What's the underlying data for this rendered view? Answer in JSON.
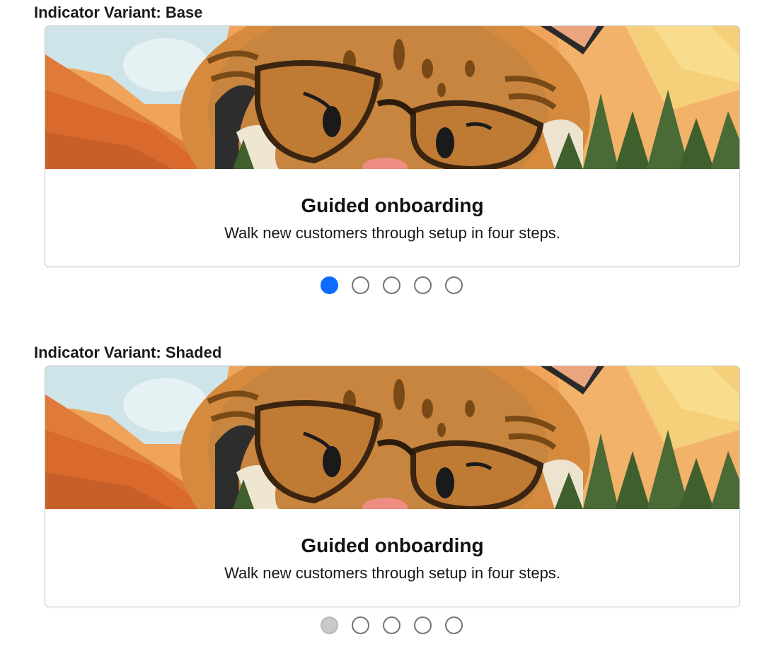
{
  "sections": [
    {
      "title": "Indicator Variant: Base",
      "card": {
        "heading": "Guided onboarding",
        "description": "Walk new customers through setup in four steps.",
        "image_alt": "illustrated-cat-with-glasses-banner"
      },
      "indicators": {
        "count": 5,
        "active_index": 0,
        "active_color": "#0b6cff",
        "style": "base"
      }
    },
    {
      "title": "Indicator Variant: Shaded",
      "card": {
        "heading": "Guided onboarding",
        "description": "Walk new customers through setup in four steps.",
        "image_alt": "illustrated-cat-with-glasses-banner"
      },
      "indicators": {
        "count": 5,
        "active_index": 0,
        "active_color": "#c9c9c9",
        "style": "shaded"
      }
    }
  ],
  "colors": {
    "indicator_border": "#747474",
    "card_border": "#c9c9c9"
  }
}
